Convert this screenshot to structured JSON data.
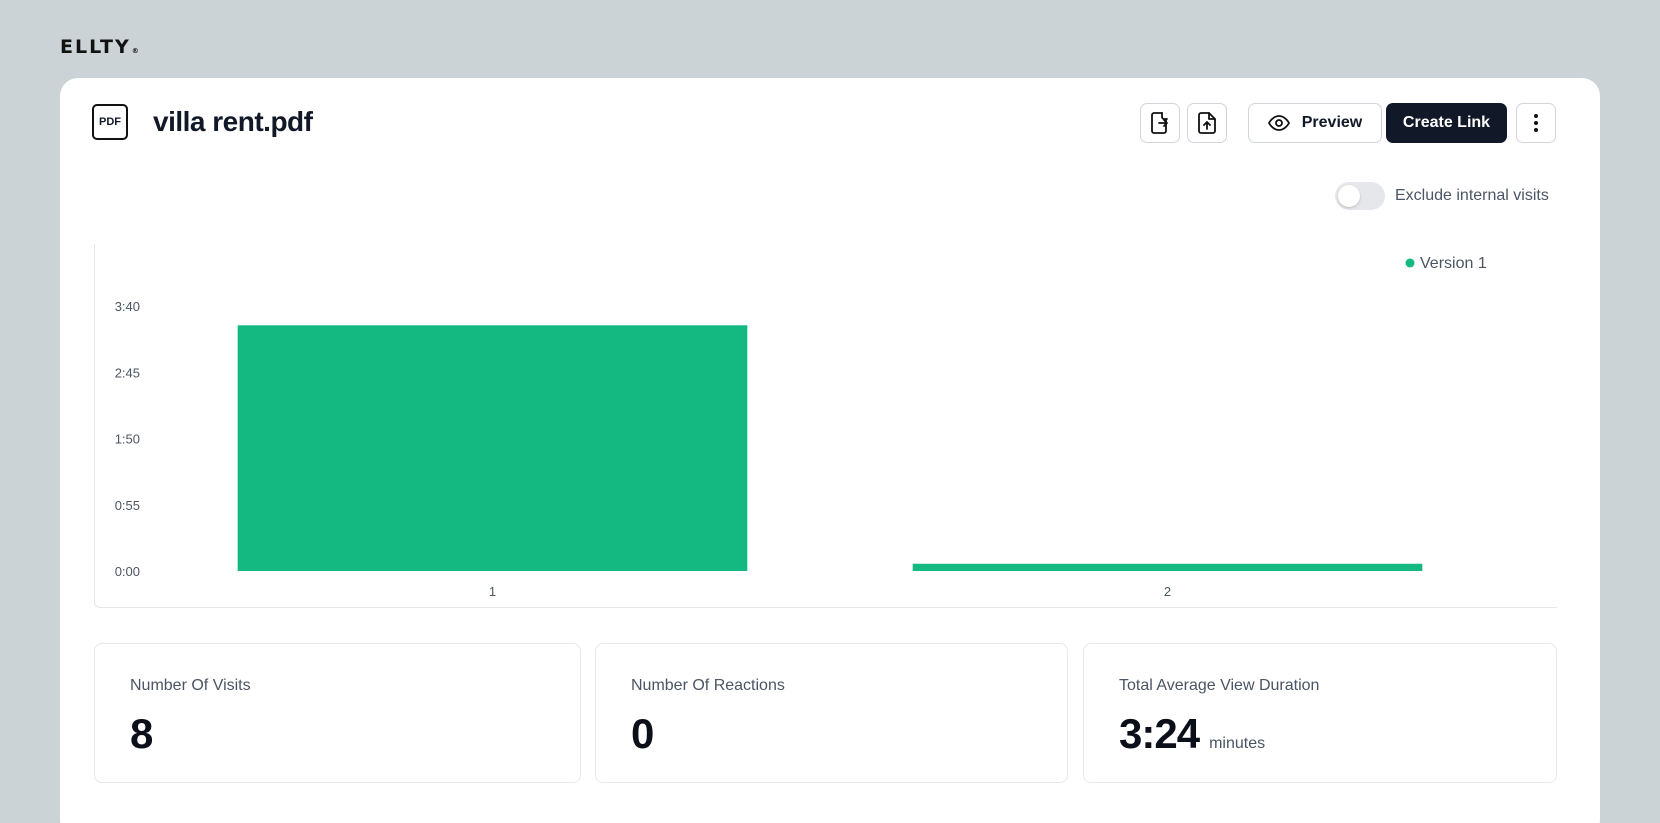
{
  "brand": {
    "logo_text": "ELLTY",
    "logo_mark": "®"
  },
  "document": {
    "type_badge": "PDF",
    "title": "villa rent.pdf"
  },
  "toolbar": {
    "replace_icon": "file-replace-icon",
    "upload_icon": "file-upload-icon",
    "preview_label": "Preview",
    "create_link_label": "Create Link",
    "more_icon": "more-vertical-icon"
  },
  "filters": {
    "exclude_internal_label": "Exclude internal visits",
    "exclude_internal_on": false
  },
  "chart_data": {
    "type": "bar",
    "categories": [
      "1",
      "2"
    ],
    "series": [
      {
        "name": "Version 1",
        "values": [
          "3:24",
          "0:06"
        ],
        "values_seconds": [
          204,
          6
        ],
        "color": "#13b981"
      }
    ],
    "y_ticks": [
      "0:00",
      "0:55",
      "1:50",
      "2:45",
      "3:40"
    ],
    "ylim_seconds": [
      0,
      220
    ],
    "legend_position": "top-right",
    "grid": false
  },
  "stats": [
    {
      "label": "Number Of Visits",
      "value": "8",
      "unit": ""
    },
    {
      "label": "Number Of Reactions",
      "value": "0",
      "unit": ""
    },
    {
      "label": "Total Average View Duration",
      "value": "3:24",
      "unit": "minutes"
    }
  ]
}
